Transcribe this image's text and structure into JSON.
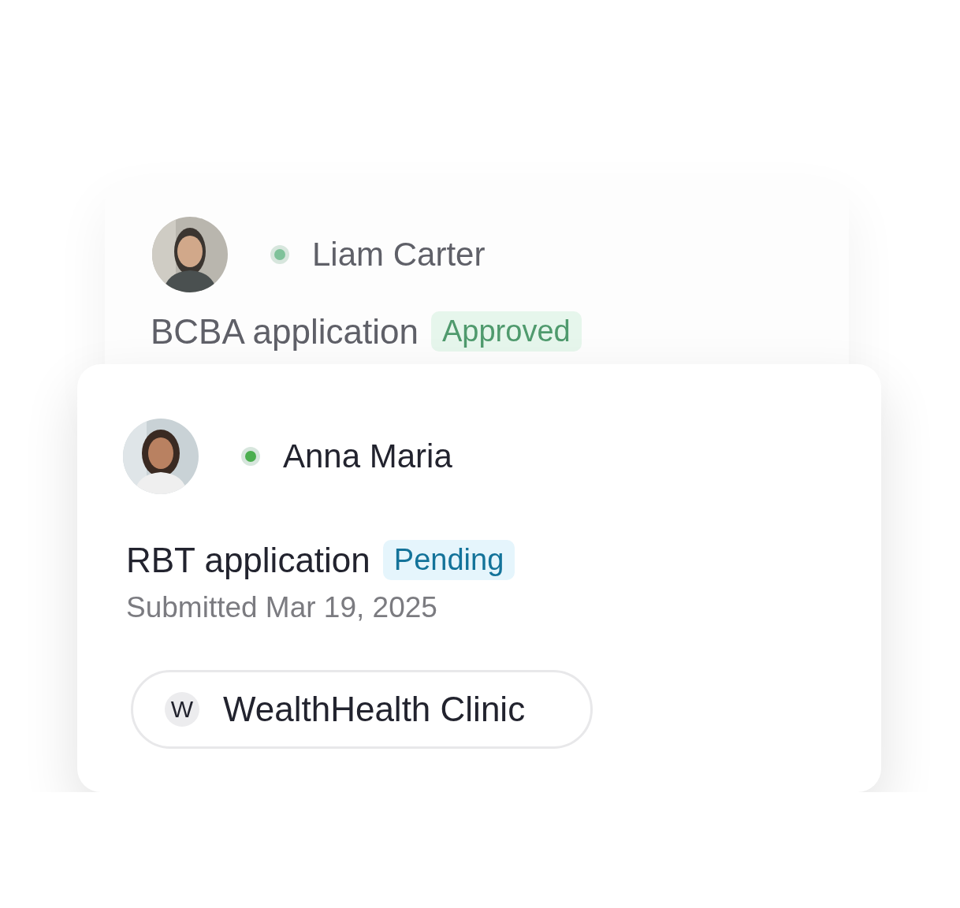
{
  "cards": [
    {
      "kind": "background",
      "name": "Liam Carter",
      "color": "#7fc29a",
      "application": "BCBA application",
      "badge": {
        "kind": "approved",
        "label": "Approved"
      }
    },
    {
      "kind": "foreground",
      "name": "Anna Maria",
      "color": "#4caf50",
      "application": "RBT application",
      "badge": {
        "kind": "pending",
        "label": "Pending"
      },
      "submitted": "Submitted Mar 19, 2025",
      "clinic": {
        "initial": "W",
        "name": "WealthHealth Clinic"
      }
    }
  ]
}
